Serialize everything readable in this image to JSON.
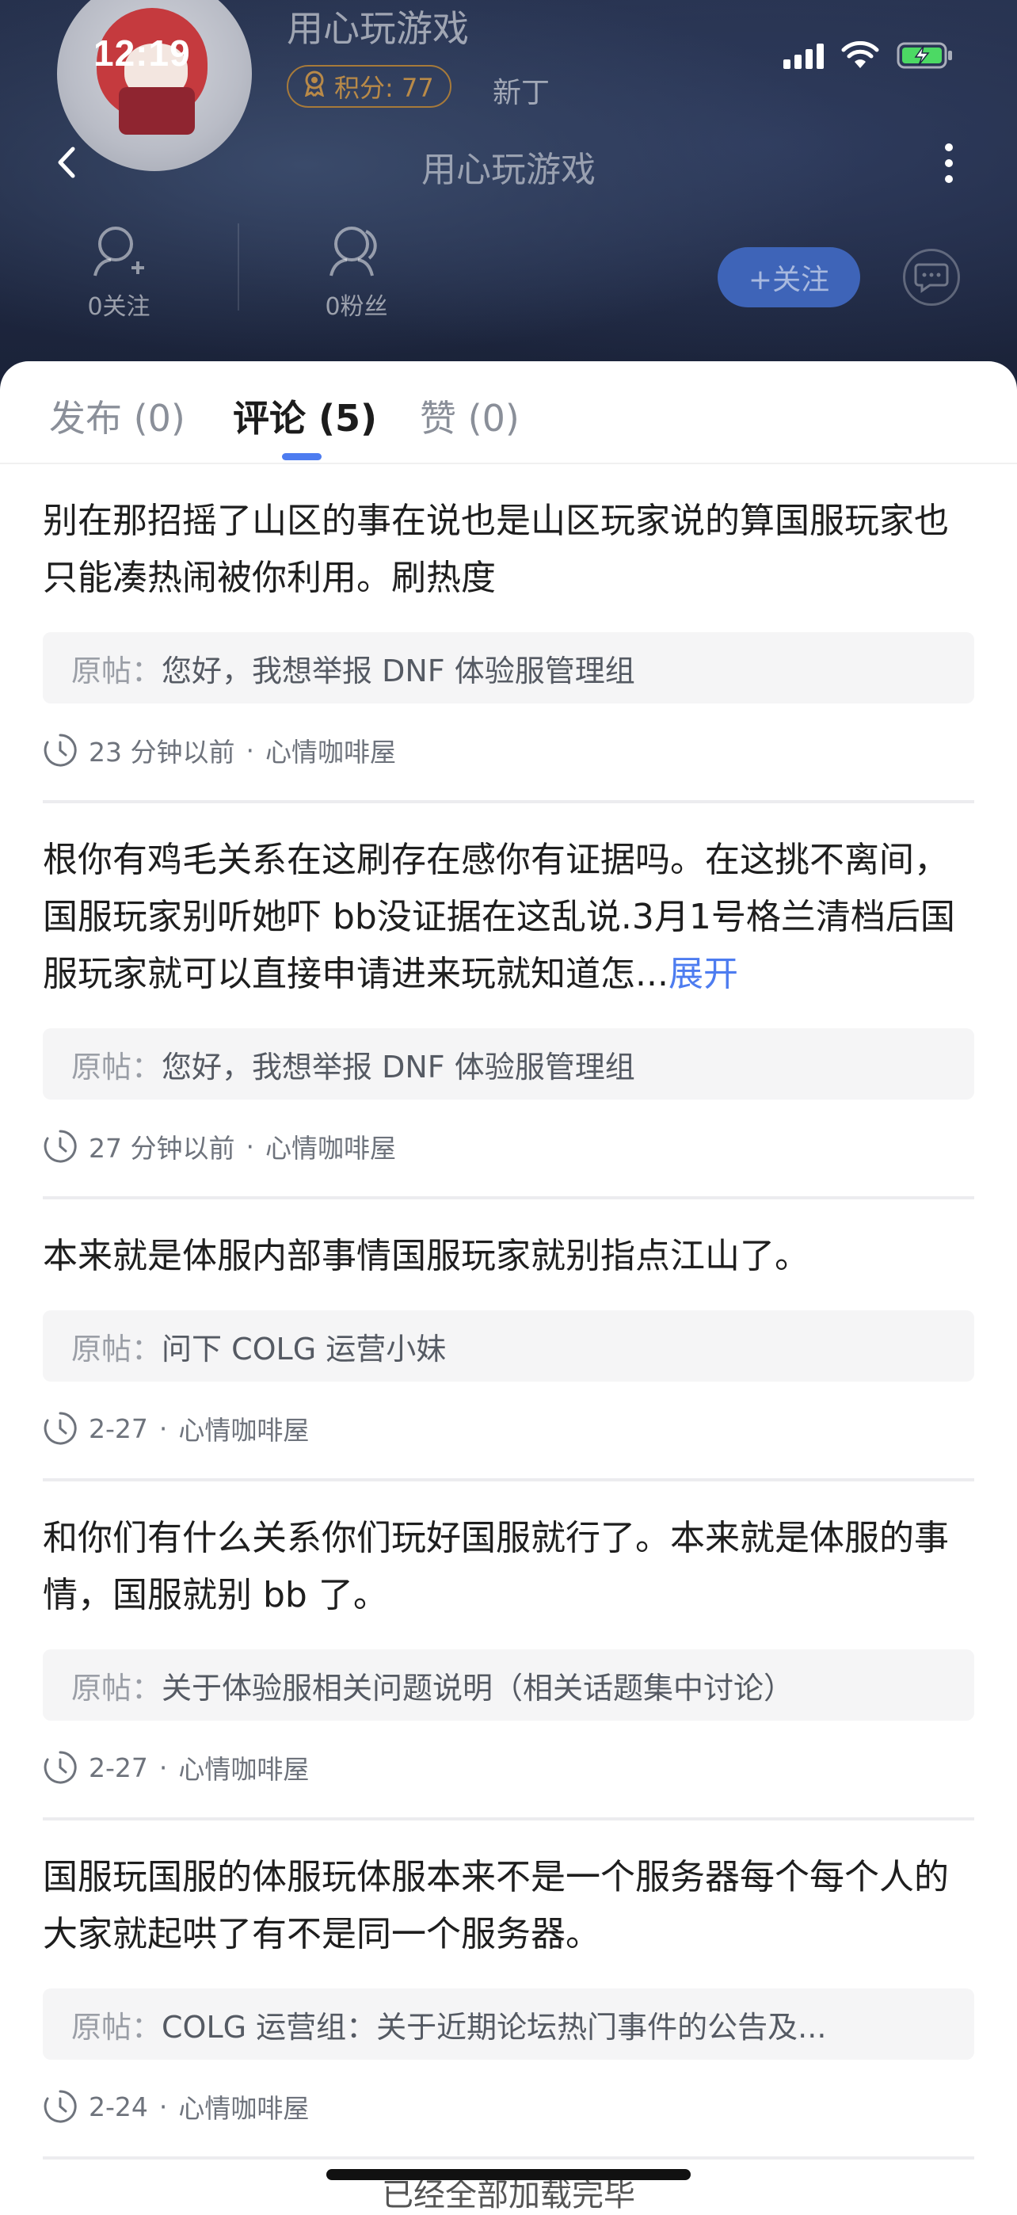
{
  "status_bar": {
    "time": "12:19"
  },
  "profile": {
    "name_top": "用心玩游戏",
    "score_badge": "积分: 77",
    "rank": "新丁",
    "nav_title": "用心玩游戏",
    "following_label": "0关注",
    "followers_label": "0粉丝",
    "follow_button": "+关注"
  },
  "tabs": [
    {
      "label": "发布 (0)"
    },
    {
      "label": "评论 (5)",
      "active": true
    },
    {
      "label": "赞 (0)"
    }
  ],
  "comments": [
    {
      "text": "别在那招摇了山区的事在说也是山区玩家说的算国服玩家也只能凑热闹被你利用。刷热度",
      "expand": "",
      "orig_prefix": "原帖：",
      "orig_title": "您好，我想举报 DNF 体验服管理组",
      "time": "23 分钟以前",
      "forum": "心情咖啡屋"
    },
    {
      "text": "根你有鸡毛关系在这刷存在感你有证据吗。在这挑不离间，国服玩家别听她吓 bb没证据在这乱说.3月1号格兰清档后国服玩家就可以直接申请进来玩就知道怎...",
      "expand": "展开",
      "orig_prefix": "原帖：",
      "orig_title": "您好，我想举报 DNF 体验服管理组",
      "time": "27 分钟以前",
      "forum": "心情咖啡屋"
    },
    {
      "text": "本来就是体服内部事情国服玩家就别指点江山了。",
      "expand": "",
      "orig_prefix": "原帖：",
      "orig_title": "问下 COLG 运营小妹",
      "time": "2-27",
      "forum": "心情咖啡屋"
    },
    {
      "text": "和你们有什么关系你们玩好国服就行了。本来就是体服的事情，国服就别 bb 了。",
      "expand": "",
      "orig_prefix": "原帖：",
      "orig_title": "关于体验服相关问题说明（相关话题集中讨论）",
      "time": "2-27",
      "forum": "心情咖啡屋"
    },
    {
      "text": "国服玩国服的体服玩体服本来不是一个服务器每个每个人的大家就起哄了有不是同一个服务器。",
      "expand": "",
      "orig_prefix": "原帖：",
      "orig_title": "COLG 运营组：关于近期论坛热门事件的公告及...",
      "time": "2-24",
      "forum": "心情咖啡屋"
    }
  ],
  "footer": {
    "end_text": "已经全部加载完毕"
  },
  "colors": {
    "accent": "#4d7cf0",
    "header_bg": "#1e2740",
    "follow_bg": "#3e64b8",
    "score_badge": "#b98a48"
  }
}
